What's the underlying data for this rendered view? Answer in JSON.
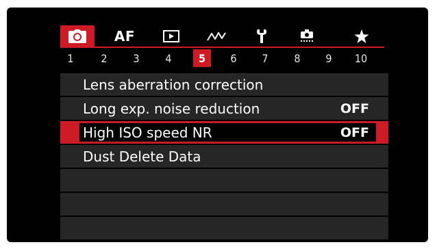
{
  "menu": {
    "tabs": [
      {
        "name": "shooting",
        "icon": "camera-icon",
        "label": ""
      },
      {
        "name": "af",
        "icon": "",
        "label": "AF"
      },
      {
        "name": "playback",
        "icon": "playback-icon",
        "label": ""
      },
      {
        "name": "wireless",
        "icon": "wireless-icon",
        "label": ""
      },
      {
        "name": "setup",
        "icon": "wrench-icon",
        "label": ""
      },
      {
        "name": "custom-functions",
        "icon": "custom-functions-icon",
        "label": ""
      },
      {
        "name": "my-menu",
        "icon": "star-icon",
        "label": ""
      }
    ],
    "active_tab": "shooting",
    "pages": [
      "1",
      "2",
      "3",
      "4",
      "5",
      "6",
      "7",
      "8",
      "9",
      "10"
    ],
    "active_page": "5",
    "items": [
      {
        "label": "Lens aberration correction",
        "value": ""
      },
      {
        "label": "Long exp. noise reduction",
        "value": "OFF"
      },
      {
        "label": "High ISO speed NR",
        "value": "OFF"
      },
      {
        "label": "Dust Delete Data",
        "value": ""
      },
      {
        "label": "",
        "value": ""
      },
      {
        "label": "",
        "value": ""
      },
      {
        "label": "",
        "value": ""
      }
    ],
    "selected_item": "High ISO speed NR"
  },
  "colors": {
    "accent": "#cc1b25",
    "row_bg": "#262626",
    "screen_bg": "#000000",
    "text": "#ffffff"
  }
}
